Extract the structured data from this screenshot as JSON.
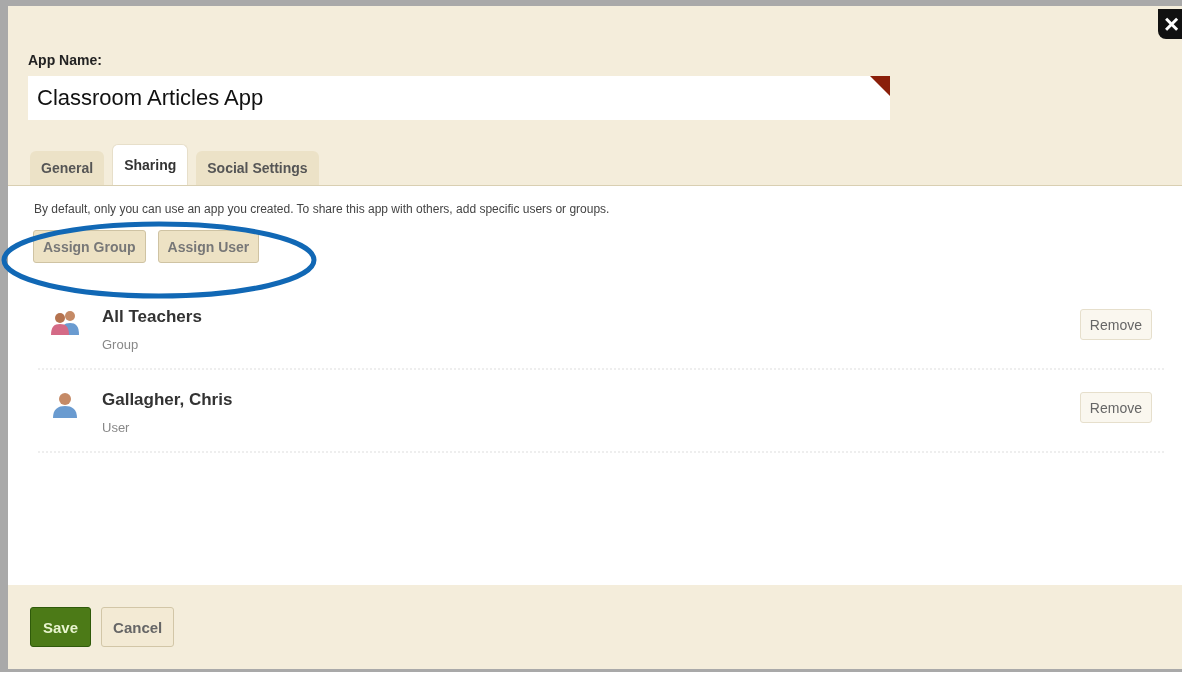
{
  "close_button": {
    "label": "×"
  },
  "app_name": {
    "label": "App Name:",
    "value": "Classroom Articles App"
  },
  "tabs": [
    {
      "label": "General",
      "selected": false
    },
    {
      "label": "Sharing",
      "selected": true
    },
    {
      "label": "Social Settings",
      "selected": false
    }
  ],
  "sharing": {
    "description": "By default, only you can use an app you created. To share this app with others, add specific users or groups.",
    "buttons": [
      "Assign Group",
      "Assign User"
    ],
    "members": [
      {
        "kind": "group",
        "name": "All Teachers",
        "type": "Group",
        "action": "Remove"
      },
      {
        "kind": "user",
        "name": "Gallagher, Chris",
        "type": "User",
        "action": "Remove"
      }
    ]
  },
  "footer": {
    "save": "Save",
    "cancel": "Cancel"
  }
}
